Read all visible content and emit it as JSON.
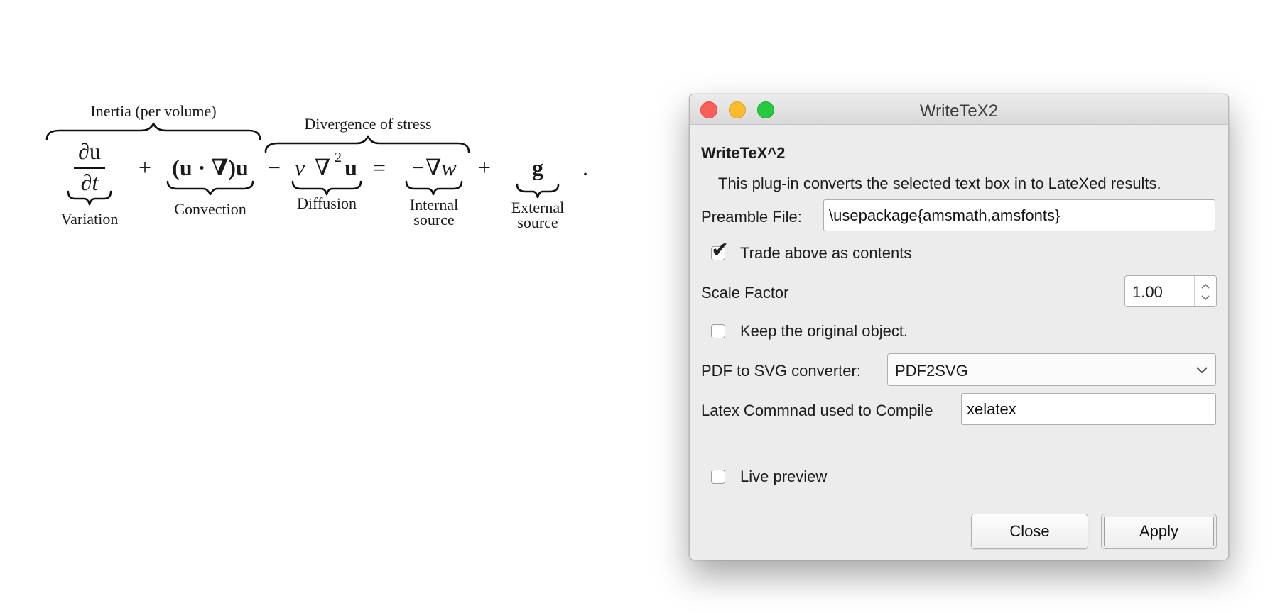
{
  "equation": {
    "terms": {
      "du": "∂u",
      "dt": "∂t",
      "plus1": "+",
      "convection": "(u · ∇)u",
      "minus": "−",
      "diffusion_nu": "ν",
      "diffusion_lap": "∇",
      "diffusion_sup": "2",
      "diffusion_u": "u",
      "equals": "=",
      "internal": "−∇w",
      "plus2": "+",
      "external": "g",
      "period": "."
    },
    "labels": {
      "inertia": "Inertia (per volume)",
      "divergence": "Divergence of stress",
      "variation": "Variation",
      "convection": "Convection",
      "diffusion": "Diffusion",
      "internal_1": "Internal",
      "internal_2": "source",
      "external_1": "External",
      "external_2": "source"
    }
  },
  "window": {
    "title": "WriteTeX2",
    "heading": "WriteTeX^2",
    "description": "This plug-in converts the selected text box in to LateXed results.",
    "preamble": {
      "label": "Preamble File:",
      "value": "\\usepackage{amsmath,amsfonts}"
    },
    "trade_above": {
      "label": "Trade above as contents",
      "checked": true
    },
    "scale": {
      "label": "Scale Factor",
      "value": "1.00"
    },
    "keep_original": {
      "label": "Keep the original object.",
      "checked": false
    },
    "converter": {
      "label": "PDF to SVG converter:",
      "value": "PDF2SVG"
    },
    "latex_command": {
      "label": "Latex Commnad used to Compile",
      "value": "xelatex"
    },
    "live_preview": {
      "label": "Live preview",
      "checked": false
    },
    "buttons": {
      "close": "Close",
      "apply": "Apply"
    },
    "colors": {
      "close": "#fc5f57",
      "minimize": "#fdbc2e",
      "maximize": "#28c840"
    }
  }
}
